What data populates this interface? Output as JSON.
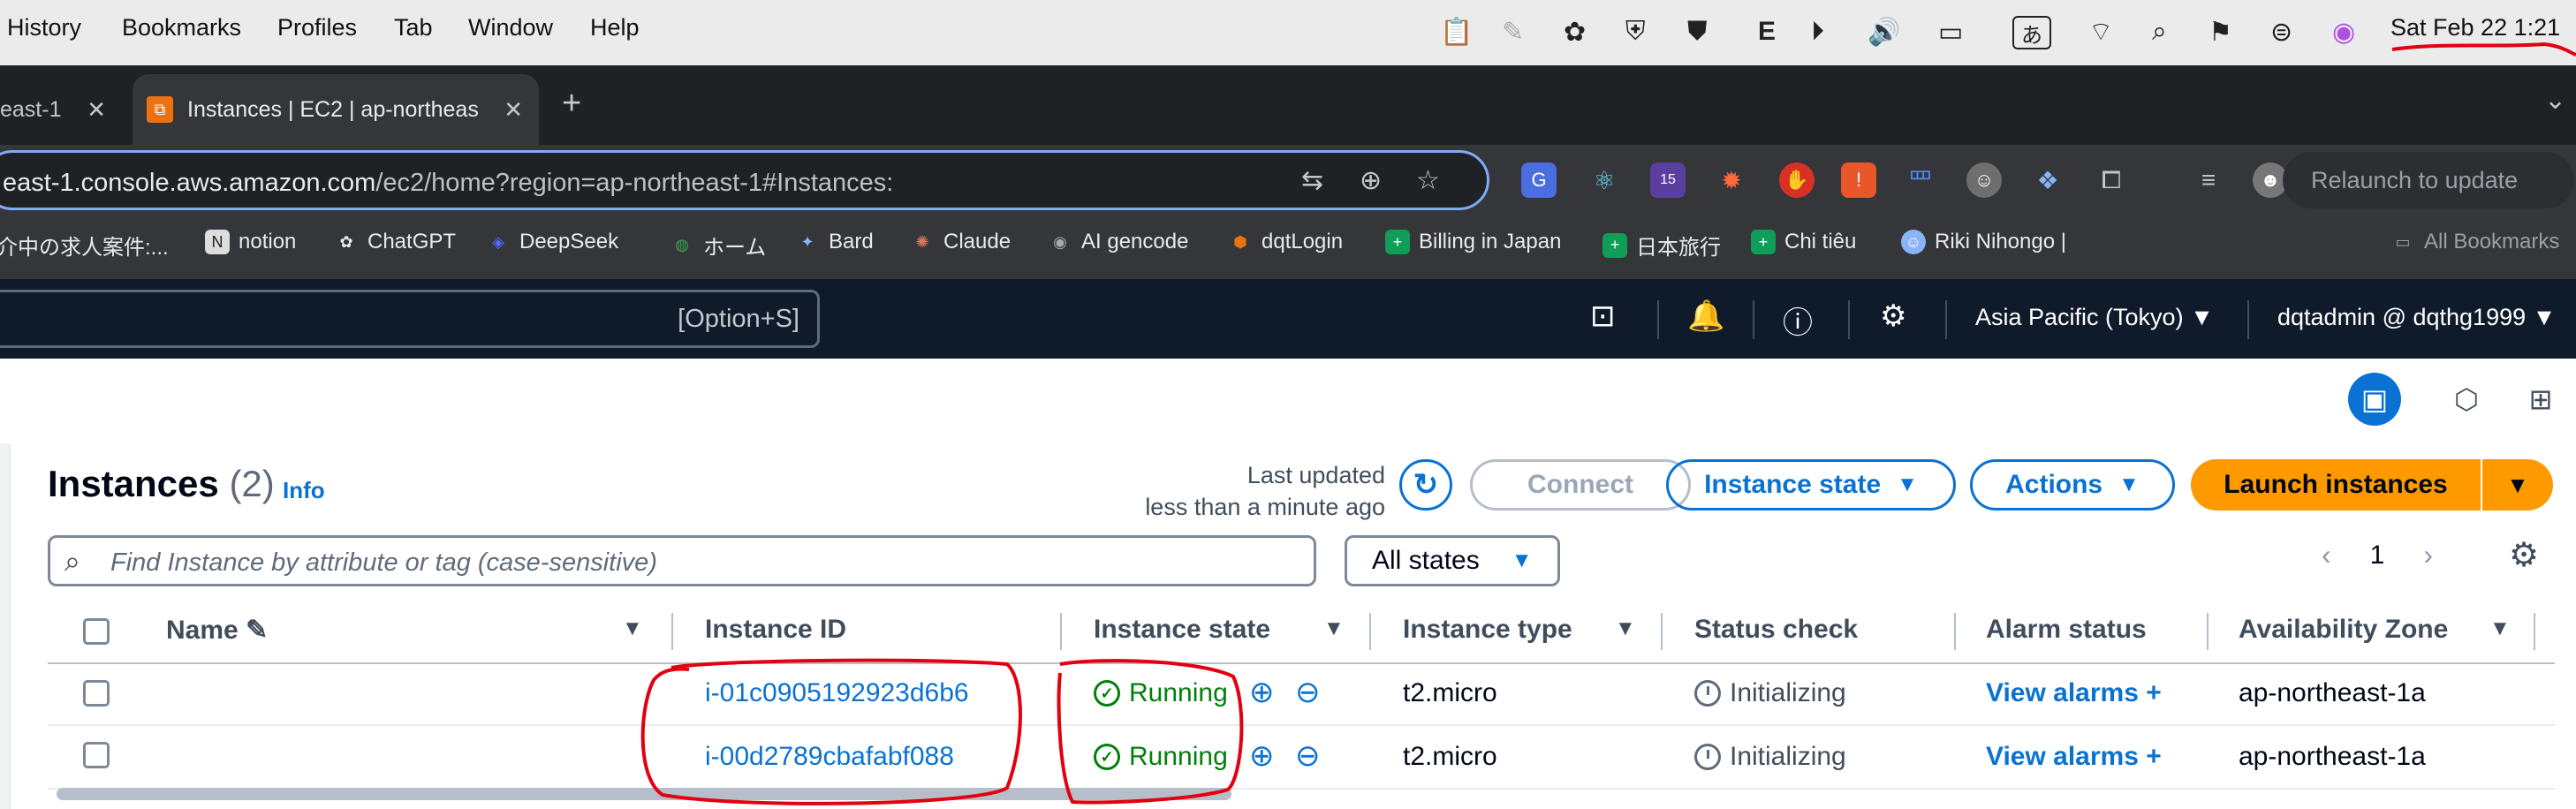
{
  "menubar": {
    "items": [
      "History",
      "Bookmarks",
      "Profiles",
      "Tab",
      "Window",
      "Help"
    ],
    "clock": "Sat Feb 22  1:21",
    "tray_icons": [
      "clipboard-icon",
      "feather-icon",
      "chatgpt-icon",
      "shield-icon",
      "security-icon",
      "e-icon",
      "play-icon",
      "volume-icon",
      "battery-icon",
      "input-method-icon",
      "wifi-icon",
      "search-icon",
      "flag-icon",
      "control-center-icon",
      "siri-icon"
    ],
    "input_method_label": "あ",
    "e_label": "E"
  },
  "browser": {
    "tabs": [
      {
        "label": "east-1",
        "active": false
      },
      {
        "label": "Instances | EC2 | ap-northeas",
        "active": true
      }
    ],
    "new_tab": "+",
    "url_host": "east-1.console.aws.amazon.com",
    "url_path": "/ec2/home?region=ap-northeast-1#Instances:",
    "ext_badge": "15",
    "relaunch": "Relaunch to update",
    "bookmarks": [
      {
        "label": "介中の求人案件:...",
        "icon": "page-icon"
      },
      {
        "label": "notion",
        "icon": "notion-icon"
      },
      {
        "label": "ChatGPT",
        "icon": "chatgpt-icon"
      },
      {
        "label": "DeepSeek",
        "icon": "deepseek-icon"
      },
      {
        "label": "ホーム",
        "icon": "home-icon"
      },
      {
        "label": "Bard",
        "icon": "bard-icon"
      },
      {
        "label": "Claude",
        "icon": "claude-icon"
      },
      {
        "label": "AI gencode",
        "icon": "gencode-icon"
      },
      {
        "label": "dqtLogin",
        "icon": "login-icon"
      },
      {
        "label": "Billing in Japan",
        "icon": "sheet-icon"
      },
      {
        "label": "日本旅行",
        "icon": "sheet-icon"
      },
      {
        "label": "Chi tiêu",
        "icon": "sheet-icon"
      },
      {
        "label": "Riki Nihongo |",
        "icon": "riki-icon"
      }
    ],
    "all_bookmarks": "All Bookmarks"
  },
  "aws_header": {
    "search_shortcut": "[Option+S]",
    "region": "Asia Pacific (Tokyo)",
    "account": "dqtadmin @ dqthg1999"
  },
  "instances": {
    "title": "Instances",
    "count": "(2)",
    "info": "Info",
    "last_updated_line1": "Last updated",
    "last_updated_line2": "less than a minute ago",
    "buttons": {
      "connect": "Connect",
      "instance_state": "Instance state",
      "actions": "Actions",
      "launch": "Launch instances"
    },
    "search_placeholder": "Find Instance by attribute or tag (case-sensitive)",
    "states_filter": "All states",
    "page": "1",
    "columns": [
      "Name",
      "Instance ID",
      "Instance state",
      "Instance type",
      "Status check",
      "Alarm status",
      "Availability Zone"
    ],
    "rows": [
      {
        "name": "",
        "id": "i-01c0905192923d6b6",
        "state": "Running",
        "type": "t2.micro",
        "status": "Initializing",
        "alarm": "View alarms",
        "az": "ap-northeast-1a"
      },
      {
        "name": "",
        "id": "i-00d2789cbafabf088",
        "state": "Running",
        "type": "t2.micro",
        "status": "Initializing",
        "alarm": "View alarms",
        "az": "ap-northeast-1a"
      }
    ]
  },
  "colors": {
    "aws_blue": "#0972d3",
    "aws_orange": "#ff9900",
    "running_green": "#037f0c",
    "annotation_red": "#e3000f",
    "aws_header": "#0f1b2a"
  }
}
